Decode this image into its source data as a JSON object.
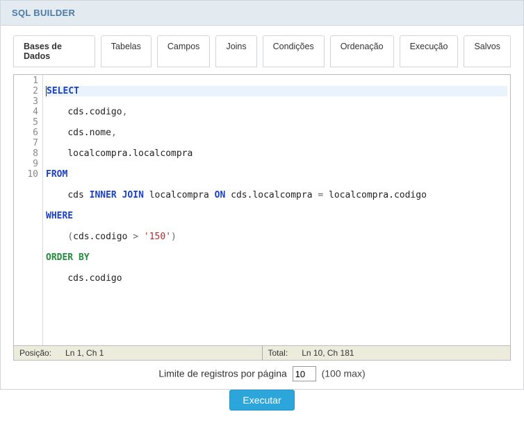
{
  "header": {
    "title": "SQL BUILDER"
  },
  "tabs": [
    "Bases de Dados",
    "Tabelas",
    "Campos",
    "Joins",
    "Condições",
    "Ordenação",
    "Execução",
    "Salvos"
  ],
  "editor": {
    "line_numbers": [
      "1",
      "2",
      "3",
      "4",
      "5",
      "6",
      "7",
      "8",
      "9",
      "10"
    ],
    "lines": {
      "l1_kw": "SELECT",
      "l2_indent": "    ",
      "l2_txt": "cds.codigo",
      "l2_comma": ",",
      "l3_indent": "    ",
      "l3_txt": "cds.nome",
      "l3_comma": ",",
      "l4_indent": "    ",
      "l4_txt": "localcompra.localcompra",
      "l5_kw": "FROM",
      "l6_indent": "    ",
      "l6_t1": "cds ",
      "l6_kw1": "INNER",
      "l6_sp1": " ",
      "l6_kw2": "JOIN",
      "l6_sp2": " localcompra ",
      "l6_kw3": "ON",
      "l6_t2": " cds.localcompra ",
      "l6_eq": "=",
      "l6_t3": " localcompra.codigo",
      "l7_kw": "WHERE",
      "l8_indent": "    ",
      "l8_p1": "(",
      "l8_t1": "cds.codigo ",
      "l8_op": ">",
      "l8_sp": " ",
      "l8_str": "'150'",
      "l8_p2": ")",
      "l9_t1": "ORDER",
      "l9_sp": " ",
      "l9_t2": "BY",
      "l10_indent": "    ",
      "l10_txt": "cds.codigo"
    }
  },
  "status": {
    "pos_label": "Posição:",
    "pos_value": "Ln 1, Ch 1",
    "total_label": "Total:",
    "total_value": "Ln 10, Ch 181"
  },
  "limit": {
    "label": "Limite de registros por página",
    "value": "10",
    "hint": "(100 max)"
  },
  "buttons": {
    "execute": "Executar"
  }
}
